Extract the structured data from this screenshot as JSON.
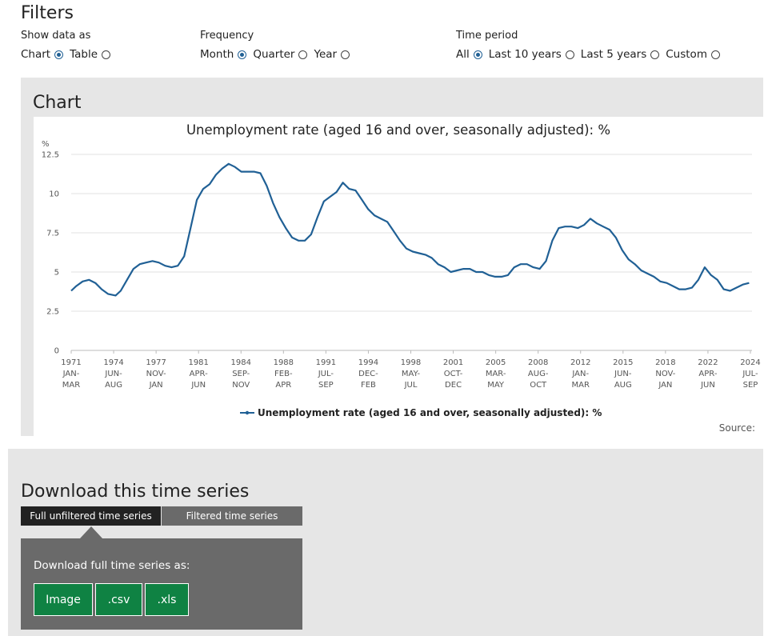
{
  "filters": {
    "title": "Filters",
    "show_data": {
      "label": "Show data as",
      "options": [
        "Chart",
        "Table"
      ],
      "selected": "Chart"
    },
    "frequency": {
      "label": "Frequency",
      "options": [
        "Month",
        "Quarter",
        "Year"
      ],
      "selected": "Month"
    },
    "time_period": {
      "label": "Time period",
      "options": [
        "All",
        "Last 10 years",
        "Last 5 years",
        "Custom"
      ],
      "selected": "All"
    }
  },
  "chart_section": {
    "heading": "Chart",
    "source_label": "Source:"
  },
  "chart_data": {
    "type": "line",
    "title": "Unemployment rate (aged 16 and over, seasonally adjusted): %",
    "ylabel": "%",
    "ylim": [
      0,
      12.5
    ],
    "yticks": [
      "0",
      "2.5",
      "5",
      "7.5",
      "10",
      "12.5"
    ],
    "xticks": [
      [
        "1971",
        "JAN-",
        "MAR"
      ],
      [
        "1974",
        "JUN-",
        "AUG"
      ],
      [
        "1977",
        "NOV-",
        "JAN"
      ],
      [
        "1981",
        "APR-",
        "JUN"
      ],
      [
        "1984",
        "SEP-",
        "NOV"
      ],
      [
        "1988",
        "FEB-",
        "APR"
      ],
      [
        "1991",
        "JUL-",
        "SEP"
      ],
      [
        "1994",
        "DEC-",
        "FEB"
      ],
      [
        "1998",
        "MAY-",
        "JUL"
      ],
      [
        "2001",
        "OCT-",
        "DEC"
      ],
      [
        "2005",
        "MAR-",
        "MAY"
      ],
      [
        "2008",
        "AUG-",
        "OCT"
      ],
      [
        "2012",
        "JAN-",
        "MAR"
      ],
      [
        "2015",
        "JUN-",
        "AUG"
      ],
      [
        "2018",
        "NOV-",
        "JAN"
      ],
      [
        "2022",
        "APR-",
        "JUN"
      ],
      [
        "2024",
        "JUL-",
        "SEP"
      ]
    ],
    "series": [
      {
        "name": "Unemployment rate (aged 16 and over, seasonally adjusted): %",
        "color": "#206095",
        "x": [
          1971.1,
          1971.5,
          1972.0,
          1972.5,
          1973.0,
          1973.5,
          1974.0,
          1974.6,
          1975.0,
          1975.5,
          1976.0,
          1976.5,
          1977.0,
          1977.5,
          1978.0,
          1978.5,
          1979.0,
          1979.5,
          1980.0,
          1980.5,
          1981.0,
          1981.5,
          1982.0,
          1982.5,
          1983.0,
          1983.5,
          1984.0,
          1984.5,
          1985.0,
          1985.5,
          1986.0,
          1986.5,
          1987.0,
          1987.5,
          1988.0,
          1988.5,
          1989.0,
          1989.5,
          1990.0,
          1990.5,
          1991.0,
          1991.5,
          1992.0,
          1992.5,
          1993.0,
          1993.5,
          1994.0,
          1994.5,
          1995.0,
          1995.5,
          1996.0,
          1996.5,
          1997.0,
          1997.5,
          1998.0,
          1998.5,
          1999.0,
          1999.5,
          2000.0,
          2000.5,
          2001.0,
          2001.5,
          2002.0,
          2002.5,
          2003.0,
          2003.5,
          2004.0,
          2004.5,
          2005.0,
          2005.5,
          2006.0,
          2006.5,
          2007.0,
          2007.5,
          2008.0,
          2008.5,
          2009.0,
          2009.5,
          2010.0,
          2010.5,
          2011.0,
          2011.5,
          2012.0,
          2012.5,
          2013.0,
          2013.5,
          2014.0,
          2014.5,
          2015.0,
          2015.5,
          2016.0,
          2016.5,
          2017.0,
          2017.5,
          2018.0,
          2018.5,
          2019.0,
          2019.5,
          2020.0,
          2020.5,
          2021.0,
          2021.5,
          2022.0,
          2022.5,
          2023.0,
          2023.5,
          2024.0,
          2024.5
        ],
        "values": [
          3.8,
          4.1,
          4.4,
          4.5,
          4.3,
          3.9,
          3.6,
          3.5,
          3.8,
          4.5,
          5.2,
          5.5,
          5.6,
          5.7,
          5.6,
          5.4,
          5.3,
          5.4,
          6.0,
          7.8,
          9.6,
          10.3,
          10.6,
          11.2,
          11.6,
          11.9,
          11.7,
          11.4,
          11.4,
          11.4,
          11.3,
          10.5,
          9.4,
          8.5,
          7.8,
          7.2,
          7.0,
          7.0,
          7.4,
          8.5,
          9.5,
          9.8,
          10.1,
          10.7,
          10.3,
          10.2,
          9.6,
          9.0,
          8.6,
          8.4,
          8.2,
          7.6,
          7.0,
          6.5,
          6.3,
          6.2,
          6.1,
          5.9,
          5.5,
          5.3,
          5.0,
          5.1,
          5.2,
          5.2,
          5.0,
          5.0,
          4.8,
          4.7,
          4.7,
          4.8,
          5.3,
          5.5,
          5.5,
          5.3,
          5.2,
          5.7,
          7.0,
          7.8,
          7.9,
          7.9,
          7.8,
          8.0,
          8.4,
          8.1,
          7.9,
          7.7,
          7.2,
          6.4,
          5.8,
          5.5,
          5.1,
          4.9,
          4.7,
          4.4,
          4.3,
          4.1,
          3.9,
          3.9,
          4.0,
          4.5,
          5.3,
          4.8,
          4.5,
          3.9,
          3.8,
          4.0,
          4.2,
          4.3
        ]
      }
    ],
    "legend_position": "bottom",
    "grid": true
  },
  "download": {
    "title": "Download this time series",
    "tabs": [
      "Full unfiltered time series",
      "Filtered time series"
    ],
    "active_tab": "Full unfiltered time series",
    "prompt": "Download full time series as:",
    "buttons": [
      "Image",
      ".csv",
      ".xls"
    ]
  },
  "colors": {
    "accent": "#206095",
    "button": "#0f8243",
    "panel": "#e6e6e6",
    "tab_dark": "#222222",
    "tab_grey": "#6a6a6a"
  }
}
